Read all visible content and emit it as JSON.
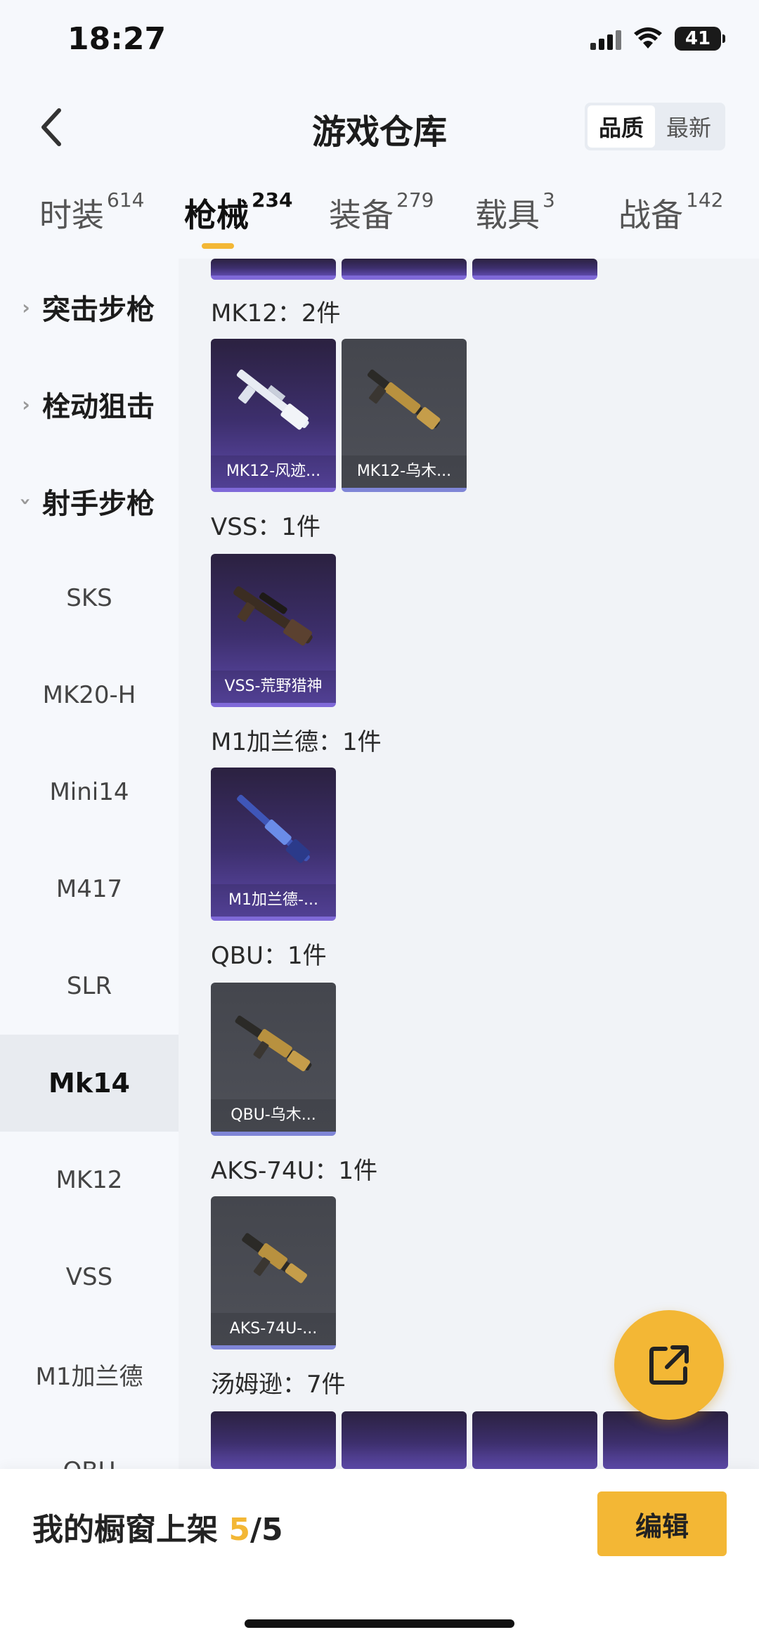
{
  "status_bar": {
    "time": "18:27",
    "battery": "41"
  },
  "header": {
    "title": "游戏仓库",
    "sort_options": [
      "品质",
      "最新"
    ],
    "active_sort": "品质"
  },
  "tabs": [
    {
      "label": "时装",
      "count": "614"
    },
    {
      "label": "枪械",
      "count": "234"
    },
    {
      "label": "装备",
      "count": "279"
    },
    {
      "label": "载具",
      "count": "3"
    },
    {
      "label": "战备",
      "count": "142"
    }
  ],
  "active_tab": "枪械",
  "sidebar": {
    "categories": [
      "突击步枪",
      "栓动狙击",
      "射手步枪"
    ],
    "subitems": [
      "SKS",
      "MK20-H",
      "Mini14",
      "M417",
      "SLR",
      "Mk14",
      "MK12",
      "VSS",
      "M1加兰德",
      "QBU"
    ],
    "active_subitem": "Mk14"
  },
  "groups": [
    {
      "title": "MK12：2件",
      "items": [
        {
          "name": "MK12-风迹...",
          "quality": "purple"
        },
        {
          "name": "MK12-乌木...",
          "quality": "gray"
        }
      ]
    },
    {
      "title": "VSS：1件",
      "items": [
        {
          "name": "VSS-荒野猎神",
          "quality": "purple"
        }
      ]
    },
    {
      "title": "M1加兰德：1件",
      "items": [
        {
          "name": "M1加兰德-...",
          "quality": "purple"
        }
      ]
    },
    {
      "title": "QBU：1件",
      "items": [
        {
          "name": "QBU-乌木...",
          "quality": "gray"
        }
      ]
    },
    {
      "title": "AKS-74U：1件",
      "items": [
        {
          "name": "AKS-74U-...",
          "quality": "gray"
        }
      ]
    },
    {
      "title": "汤姆逊：7件",
      "items": []
    }
  ],
  "icons": {
    "back": "chevron-left-icon",
    "share": "share-external-icon",
    "wifi": "wifi-icon",
    "signal": "signal-icon",
    "battery": "battery-icon"
  },
  "bottom_bar": {
    "label": "我的橱窗上架 ",
    "shelved": "5",
    "total": "/5",
    "edit_label": "编辑"
  },
  "colors": {
    "accent": "#f3b735",
    "purple_quality": "#7f69d8",
    "gray_quality": "#7f85d6"
  }
}
